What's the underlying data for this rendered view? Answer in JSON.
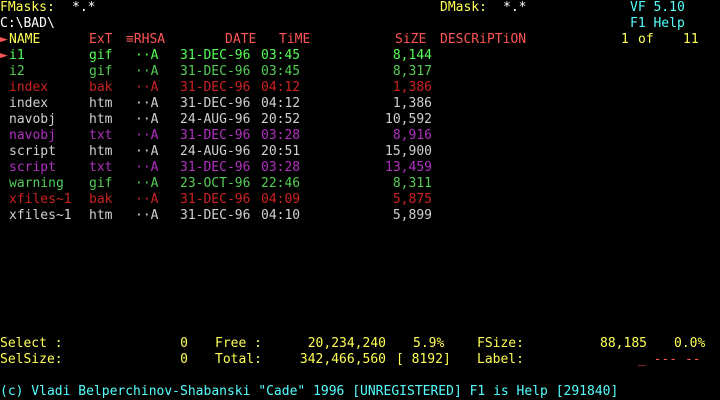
{
  "header": {
    "fmasks_label": "FMasks:",
    "fmasks_value": "*.*",
    "path": "C:\\BAD\\",
    "dmask_label": "DMask:",
    "dmask_value": "*.*",
    "version": "VF 5.10",
    "help_hint": "F1 Help",
    "page_current": "1",
    "page_of": "of",
    "page_total": "11"
  },
  "columns": {
    "name": "NAME",
    "ext": "ExT",
    "attr": "≡RHSA",
    "date": "DATE",
    "time": "TiME",
    "size": "SiZE",
    "desc": "DESCRiPTiON"
  },
  "files": [
    {
      "name": "i1",
      "ext": "gif",
      "attr": "··A",
      "date": "31-DEC-96",
      "time": "03:45",
      "size": "8,144",
      "color": "#55ff55",
      "cursor": true
    },
    {
      "name": "i2",
      "ext": "gif",
      "attr": "··A",
      "date": "31-DEC-96",
      "time": "03:45",
      "size": "8,317",
      "color": "#55cc55"
    },
    {
      "name": "index",
      "ext": "bak",
      "attr": "··A",
      "date": "31-DEC-96",
      "time": "04:12",
      "size": "1,386",
      "color": "#cc2222"
    },
    {
      "name": "index",
      "ext": "htm",
      "attr": "··A",
      "date": "31-DEC-96",
      "time": "04:12",
      "size": "1,386",
      "color": "#d0d0d0"
    },
    {
      "name": "navobj",
      "ext": "htm",
      "attr": "··A",
      "date": "24-AUG-96",
      "time": "20:52",
      "size": "10,592",
      "color": "#d0d0d0"
    },
    {
      "name": "navobj",
      "ext": "txt",
      "attr": "··A",
      "date": "31-DEC-96",
      "time": "03:28",
      "size": "8,916",
      "color": "#b030c0"
    },
    {
      "name": "script",
      "ext": "htm",
      "attr": "··A",
      "date": "24-AUG-96",
      "time": "20:51",
      "size": "15,900",
      "color": "#d0d0d0"
    },
    {
      "name": "script",
      "ext": "txt",
      "attr": "··A",
      "date": "31-DEC-96",
      "time": "03:28",
      "size": "13,459",
      "color": "#b030c0"
    },
    {
      "name": "warning",
      "ext": "gif",
      "attr": "··A",
      "date": "23-OCT-96",
      "time": "22:46",
      "size": "8,311",
      "color": "#55cc55"
    },
    {
      "name": "xfiles~1",
      "ext": "bak",
      "attr": "··A",
      "date": "31-DEC-96",
      "time": "04:09",
      "size": "5,875",
      "color": "#cc2222"
    },
    {
      "name": "xfiles~1",
      "ext": "htm",
      "attr": "··A",
      "date": "31-DEC-96",
      "time": "04:10",
      "size": "5,899",
      "color": "#d0d0d0"
    }
  ],
  "status": {
    "select_label": "Select :",
    "select_value": "0",
    "free_label": "Free :",
    "free_value": "20,234,240",
    "free_pct": "5.9%",
    "fsize_label": "FSize:",
    "fsize_value": "88,185",
    "fsize_pct": "0.0%",
    "selsize_label": "SelSize:",
    "selsize_value": "0",
    "total_label": "Total:",
    "total_value": "342,466,560",
    "cluster": "[ 8192]",
    "label_label": "Label:",
    "label_value": "_ --- --"
  },
  "footer": {
    "text": "(c) Vladi Belperchinov-Shabanski \"Cade\" 1996 [UNREGISTERED] F1 is Help [291840]"
  },
  "colors": {
    "yellow": "#ffff55",
    "cyan": "#55ffff",
    "red": "#ff5555",
    "cursor_arrow": "#ff5555"
  }
}
